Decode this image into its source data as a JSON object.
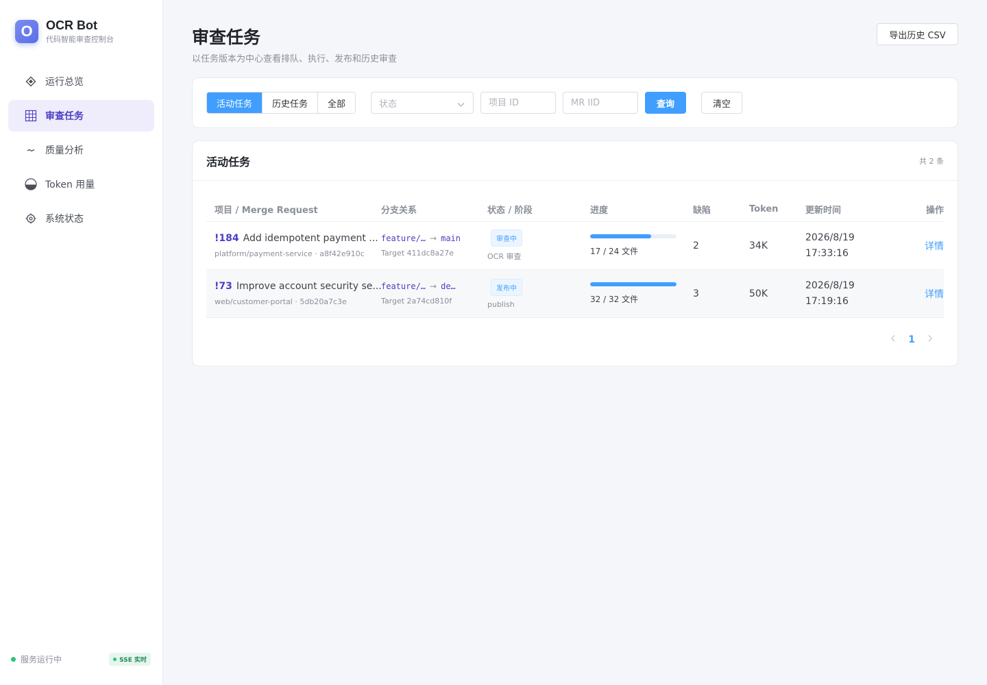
{
  "brand": {
    "logo_letter": "O",
    "title": "OCR Bot",
    "subtitle": "代码智能审查控制台"
  },
  "sidebar": {
    "items": [
      {
        "label": "运行总览",
        "icon": "diamond-icon",
        "active": false
      },
      {
        "label": "审查任务",
        "icon": "grid-icon",
        "active": true
      },
      {
        "label": "质量分析",
        "icon": "trend-icon",
        "active": false
      },
      {
        "label": "Token 用量",
        "icon": "half-circle-icon",
        "active": false
      },
      {
        "label": "系统状态",
        "icon": "gear-icon",
        "active": false
      }
    ],
    "footer": {
      "status": "服务运行中",
      "badge": "SSE 实时"
    }
  },
  "header": {
    "title": "审查任务",
    "subtitle": "以任务版本为中心查看排队、执行、发布和历史审查",
    "export_label": "导出历史 CSV"
  },
  "filters": {
    "tabs": [
      "活动任务",
      "历史任务",
      "全部"
    ],
    "active_tab": "活动任务",
    "status_placeholder": "状态",
    "project_placeholder": "项目 ID",
    "mr_placeholder": "MR IID",
    "query_label": "查询",
    "clear_label": "清空"
  },
  "table": {
    "title": "活动任务",
    "count": "共 2 条",
    "columns": [
      "项目 / Merge Request",
      "分支关系",
      "状态 / 阶段",
      "进度",
      "缺陷",
      "Token",
      "更新时间",
      "操作"
    ],
    "rows": [
      {
        "mr_id": "!184",
        "mr_title": "Add idempotent payment ...",
        "repo": "platform/payment-service · a8f42e910c",
        "source": "feature/…",
        "arrow": "→",
        "target_branch": "main",
        "target": "Target 411dc8a27e",
        "status": "审查中",
        "stage": "OCR 审查",
        "progress": 0.7083,
        "progress_text": "17 / 24 文件",
        "defects": "2",
        "token": "34K",
        "date": "2026/8/19",
        "time": "17:33:16",
        "action": "详情"
      },
      {
        "mr_id": "!73",
        "mr_title": "Improve account security se...",
        "repo": "web/customer-portal · 5db20a7c3e",
        "source": "feature/…",
        "arrow": "→",
        "target_branch": "de…",
        "target": "Target 2a74cd810f",
        "status": "发布中",
        "stage": "publish",
        "progress": 1.0,
        "progress_text": "32 / 32 文件",
        "defects": "3",
        "token": "50K",
        "date": "2026/8/19",
        "time": "17:19:16",
        "action": "详情"
      }
    ]
  },
  "pagination": {
    "current": "1",
    "prev_icon": "chevron-left-icon",
    "next_icon": "chevron-right-icon"
  },
  "colors": {
    "primary": "#409eff",
    "brand": "#4b3fc4",
    "active_nav_bg": "#efedfc",
    "success": "#2ec27e"
  }
}
